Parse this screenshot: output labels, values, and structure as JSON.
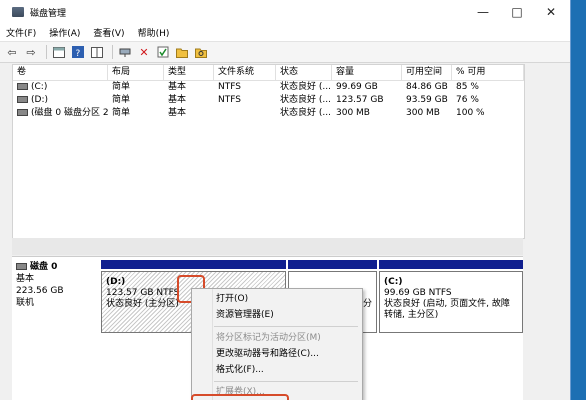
{
  "window": {
    "title": "磁盘管理"
  },
  "window_controls": {
    "minimize": "—",
    "maximize": "□",
    "close": "✕"
  },
  "menu": [
    "文件(F)",
    "操作(A)",
    "查看(V)",
    "帮助(H)"
  ],
  "toolbar_icons": [
    "back-arrow-icon",
    "forward-arrow-icon",
    "properties-icon",
    "help-icon",
    "view-icon",
    "connect-icon",
    "delete-icon",
    "check-icon",
    "folder-icon",
    "folder-search-icon"
  ],
  "volumes": {
    "columns": [
      "卷",
      "布局",
      "类型",
      "文件系统",
      "状态",
      "容量",
      "可用空间",
      "% 可用"
    ],
    "rows": [
      [
        "(C:)",
        "简单",
        "基本",
        "NTFS",
        "状态良好 (...",
        "99.69 GB",
        "84.86 GB",
        "85 %"
      ],
      [
        "(D:)",
        "简单",
        "基本",
        "NTFS",
        "状态良好 (...",
        "123.57 GB",
        "93.59 GB",
        "76 %"
      ],
      [
        "(磁盘 0 磁盘分区 2)",
        "简单",
        "基本",
        "",
        "状态良好 (...",
        "300 MB",
        "300 MB",
        "100 %"
      ]
    ]
  },
  "disk": {
    "name": "磁盘 0",
    "type": "基本",
    "size": "223.56 GB",
    "status": "联机"
  },
  "partitions": {
    "d": {
      "title": "(D:)",
      "size": "123.57 GB NTFS",
      "status": "状态良好 (主分区)"
    },
    "mid": {
      "fragment": "分"
    },
    "c": {
      "title": "(C:)",
      "size": "99.69 GB NTFS",
      "status": "状态良好 (启动, 页面文件, 故障转储, 主分区)"
    }
  },
  "context_menu": {
    "open": "打开(O)",
    "explore": "资源管理器(E)",
    "mark_active": "将分区标记为活动分区(M)",
    "change_letter": "更改驱动器号和路径(C)...",
    "format": "格式化(F)...",
    "extend": "扩展卷(X)..."
  },
  "colors": {
    "primary_partition_bar": "#101f8f",
    "highlight": "#d64b2a",
    "desktop": "#1d6fb3"
  }
}
